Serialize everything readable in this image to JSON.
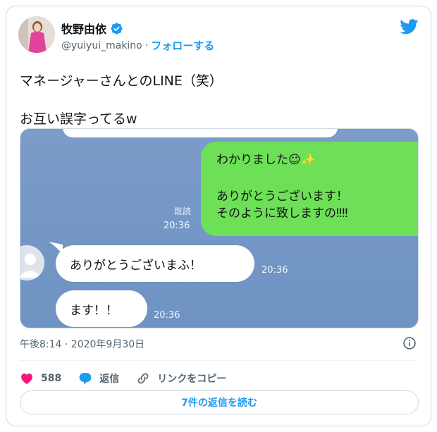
{
  "tweet": {
    "author_name": "牧野由依",
    "handle": "@yuiyui_makino",
    "separator": "·",
    "follow_label": "フォローする",
    "text_line1": "マネージャーさんとのLINE（笑）",
    "text_line2": "お互い誤字ってるw",
    "timestamp": "午後8:14 · 2020年9月30日"
  },
  "chat": {
    "my_message_line1": "わかりました☺✨",
    "my_message_line2": "ありがとうございます！",
    "my_message_line3": "そのように致しますの‼‼",
    "read_label": "既読",
    "my_time": "20:36",
    "friend_message1": "ありがとうございまふ！",
    "friend_time1": "20:36",
    "friend_message2": "ます！！",
    "friend_time2": "20:36"
  },
  "actions": {
    "like_count": "588",
    "reply_label": "返信",
    "copy_link_label": "リンクをコピー"
  },
  "read_replies_label": "7件の返信を読む",
  "colors": {
    "twitter_blue": "#1d9bf0",
    "like_pink": "#f91880",
    "line_green": "#6de058",
    "chat_background": "#7497c6"
  }
}
